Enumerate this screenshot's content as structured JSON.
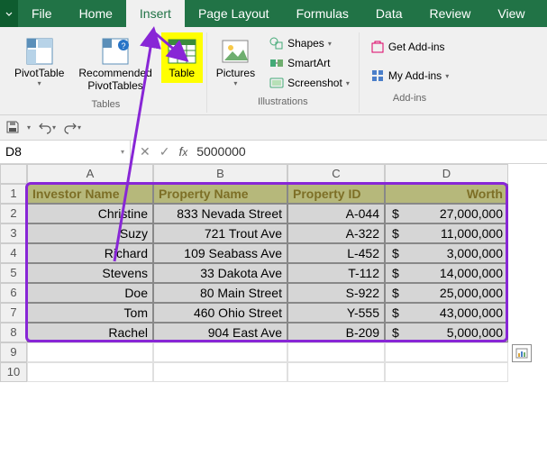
{
  "menubar": {
    "tabs": [
      "File",
      "Home",
      "Insert",
      "Page Layout",
      "Formulas",
      "Data",
      "Review",
      "View"
    ],
    "active": 2
  },
  "ribbon": {
    "groups": [
      {
        "label": "Tables",
        "items": [
          {
            "name": "pivottable-button",
            "label": "PivotTable",
            "hi": false
          },
          {
            "name": "recommended-pivottables-button",
            "label": "Recommended\nPivotTables",
            "hi": false
          },
          {
            "name": "table-button",
            "label": "Table",
            "hi": true
          }
        ]
      },
      {
        "label": "Illustrations",
        "items": [
          {
            "name": "pictures-button",
            "label": "Pictures",
            "hi": false
          }
        ],
        "small": [
          {
            "name": "shapes-button",
            "label": "Shapes",
            "drop": true
          },
          {
            "name": "smartart-button",
            "label": "SmartArt",
            "drop": false
          },
          {
            "name": "screenshot-button",
            "label": "Screenshot",
            "drop": true
          }
        ]
      },
      {
        "label": "Add-ins",
        "small": [
          {
            "name": "get-addins-button",
            "label": "Get Add-ins",
            "drop": false
          },
          {
            "name": "my-addins-button",
            "label": "My Add-ins",
            "drop": true
          }
        ]
      }
    ]
  },
  "name_box": "D8",
  "formula_value": "5000000",
  "columns": [
    "A",
    "B",
    "C",
    "D"
  ],
  "row_numbers": [
    "1",
    "2",
    "3",
    "4",
    "5",
    "6",
    "7",
    "8",
    "9",
    "10"
  ],
  "headers": [
    "Investor Name",
    "Property Name",
    "Property ID",
    "Worth"
  ],
  "chart_data": {
    "type": "table",
    "columns": [
      "Investor Name",
      "Property Name",
      "Property ID",
      "Worth"
    ],
    "rows": [
      [
        "Christine",
        "833 Nevada Street",
        "A-044",
        27000000
      ],
      [
        "Suzy",
        "721 Trout Ave",
        "A-322",
        11000000
      ],
      [
        "Richard",
        "109 Seabass Ave",
        "L-452",
        3000000
      ],
      [
        "Stevens",
        "33 Dakota Ave",
        "T-112",
        14000000
      ],
      [
        "Doe",
        "80 Main Street",
        "S-922",
        25000000
      ],
      [
        "Tom",
        "460 Ohio Street",
        "Y-555",
        43000000
      ],
      [
        "Rachel",
        "904 East Ave",
        "B-209",
        5000000
      ]
    ]
  },
  "display_rows": [
    [
      "Christine",
      "833 Nevada Street",
      "A-044",
      "27,000,000"
    ],
    [
      "Suzy",
      "721 Trout Ave",
      "A-322",
      "11,000,000"
    ],
    [
      "Richard",
      "109 Seabass Ave",
      "L-452",
      "3,000,000"
    ],
    [
      "Stevens",
      "33 Dakota Ave",
      "T-112",
      "14,000,000"
    ],
    [
      "Doe",
      "80 Main Street",
      "S-922",
      "25,000,000"
    ],
    [
      "Tom",
      "460 Ohio Street",
      "Y-555",
      "43,000,000"
    ],
    [
      "Rachel",
      "904 East Ave",
      "B-209",
      "5,000,000"
    ]
  ],
  "currency": "$"
}
